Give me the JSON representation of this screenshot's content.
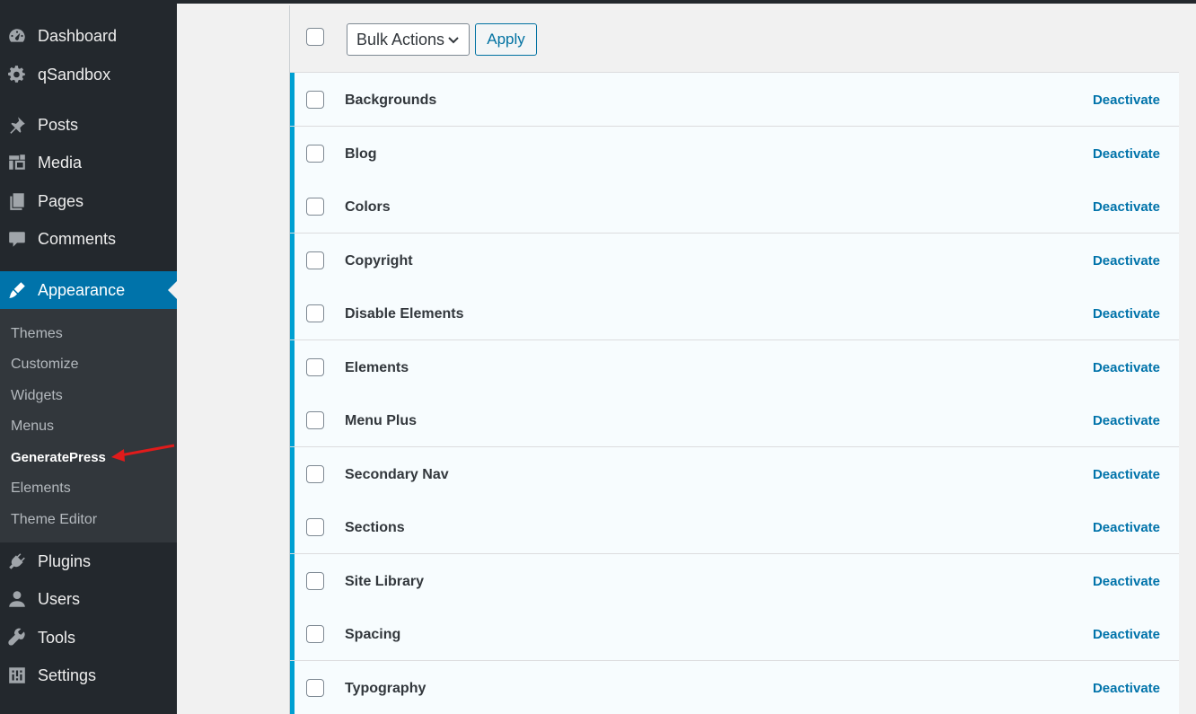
{
  "sidebar": {
    "menu": [
      {
        "label": "Dashboard",
        "icon": "dashboard-icon"
      },
      {
        "label": "qSandbox",
        "icon": "gear-icon"
      },
      {
        "label": "Posts",
        "icon": "pin-icon"
      },
      {
        "label": "Media",
        "icon": "media-icon"
      },
      {
        "label": "Pages",
        "icon": "pages-icon"
      },
      {
        "label": "Comments",
        "icon": "comment-icon"
      },
      {
        "label": "Appearance",
        "icon": "brush-icon"
      },
      {
        "label": "Plugins",
        "icon": "plugin-icon"
      },
      {
        "label": "Users",
        "icon": "user-icon"
      },
      {
        "label": "Tools",
        "icon": "wrench-icon"
      },
      {
        "label": "Settings",
        "icon": "settings-icon"
      }
    ],
    "submenu": [
      {
        "label": "Themes"
      },
      {
        "label": "Customize"
      },
      {
        "label": "Widgets"
      },
      {
        "label": "Menus"
      },
      {
        "label": "GeneratePress"
      },
      {
        "label": "Elements"
      },
      {
        "label": "Theme Editor"
      }
    ]
  },
  "toolbar": {
    "bulk_actions": "Bulk Actions",
    "apply": "Apply"
  },
  "modules": [
    {
      "name": "Backgrounds",
      "action": "Deactivate"
    },
    {
      "name": "Blog",
      "action": "Deactivate"
    },
    {
      "name": "Colors",
      "action": "Deactivate"
    },
    {
      "name": "Copyright",
      "action": "Deactivate"
    },
    {
      "name": "Disable Elements",
      "action": "Deactivate"
    },
    {
      "name": "Elements",
      "action": "Deactivate"
    },
    {
      "name": "Menu Plus",
      "action": "Deactivate"
    },
    {
      "name": "Secondary Nav",
      "action": "Deactivate"
    },
    {
      "name": "Sections",
      "action": "Deactivate"
    },
    {
      "name": "Site Library",
      "action": "Deactivate"
    },
    {
      "name": "Spacing",
      "action": "Deactivate"
    },
    {
      "name": "Typography",
      "action": "Deactivate"
    }
  ],
  "colors": {
    "sidebar_bg": "#23282d",
    "active_bg": "#0073aa",
    "link": "#0073aa",
    "row_accent": "#00a0d2",
    "annotation_arrow": "#e01b1b"
  }
}
